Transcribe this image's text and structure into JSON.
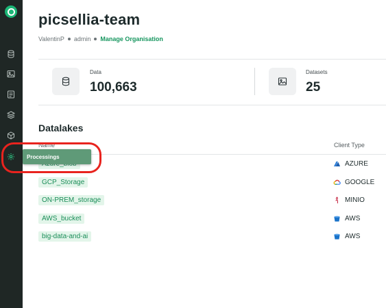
{
  "header": {
    "title": "picsellia-team",
    "breadcrumb": {
      "user": "ValentinP",
      "role": "admin",
      "link": "Manage Organisation"
    }
  },
  "stats": [
    {
      "label": "Data",
      "value": "100,663",
      "icon": "database-icon"
    },
    {
      "label": "Datasets",
      "value": "25",
      "icon": "image-icon"
    }
  ],
  "sidebar": {
    "items": [
      {
        "name": "datalake",
        "icon": "database-icon"
      },
      {
        "name": "datasets",
        "icon": "image-icon"
      },
      {
        "name": "experiments",
        "icon": "experiment-icon"
      },
      {
        "name": "models",
        "icon": "layers-icon"
      },
      {
        "name": "deployments",
        "icon": "deploy-icon"
      },
      {
        "name": "processings",
        "icon": "gear-icon"
      }
    ],
    "tooltip": "Processings"
  },
  "datalakes": {
    "title": "Datalakes",
    "columns": {
      "name": "Name",
      "client_type": "Client Type"
    },
    "rows": [
      {
        "name": "Azure_blob",
        "client": "AZURE",
        "icon": "azure-icon",
        "color": "#2f7fd6"
      },
      {
        "name": "GCP_Storage",
        "client": "GOOGLE",
        "icon": "google-cloud-icon",
        "color": "#ea4335"
      },
      {
        "name": "ON-PREM_storage",
        "client": "MINIO",
        "icon": "minio-icon",
        "color": "#c72c48"
      },
      {
        "name": "AWS_bucket",
        "client": "AWS",
        "icon": "aws-bucket-icon",
        "color": "#1a73c9"
      },
      {
        "name": "big-data-and-ai",
        "client": "AWS",
        "icon": "aws-bucket-icon",
        "color": "#1a73c9"
      }
    ]
  },
  "colors": {
    "accent": "#17965f",
    "sidebar": "#1f2725",
    "tooltip": "#5f9a78",
    "highlight": "#e8231e"
  }
}
